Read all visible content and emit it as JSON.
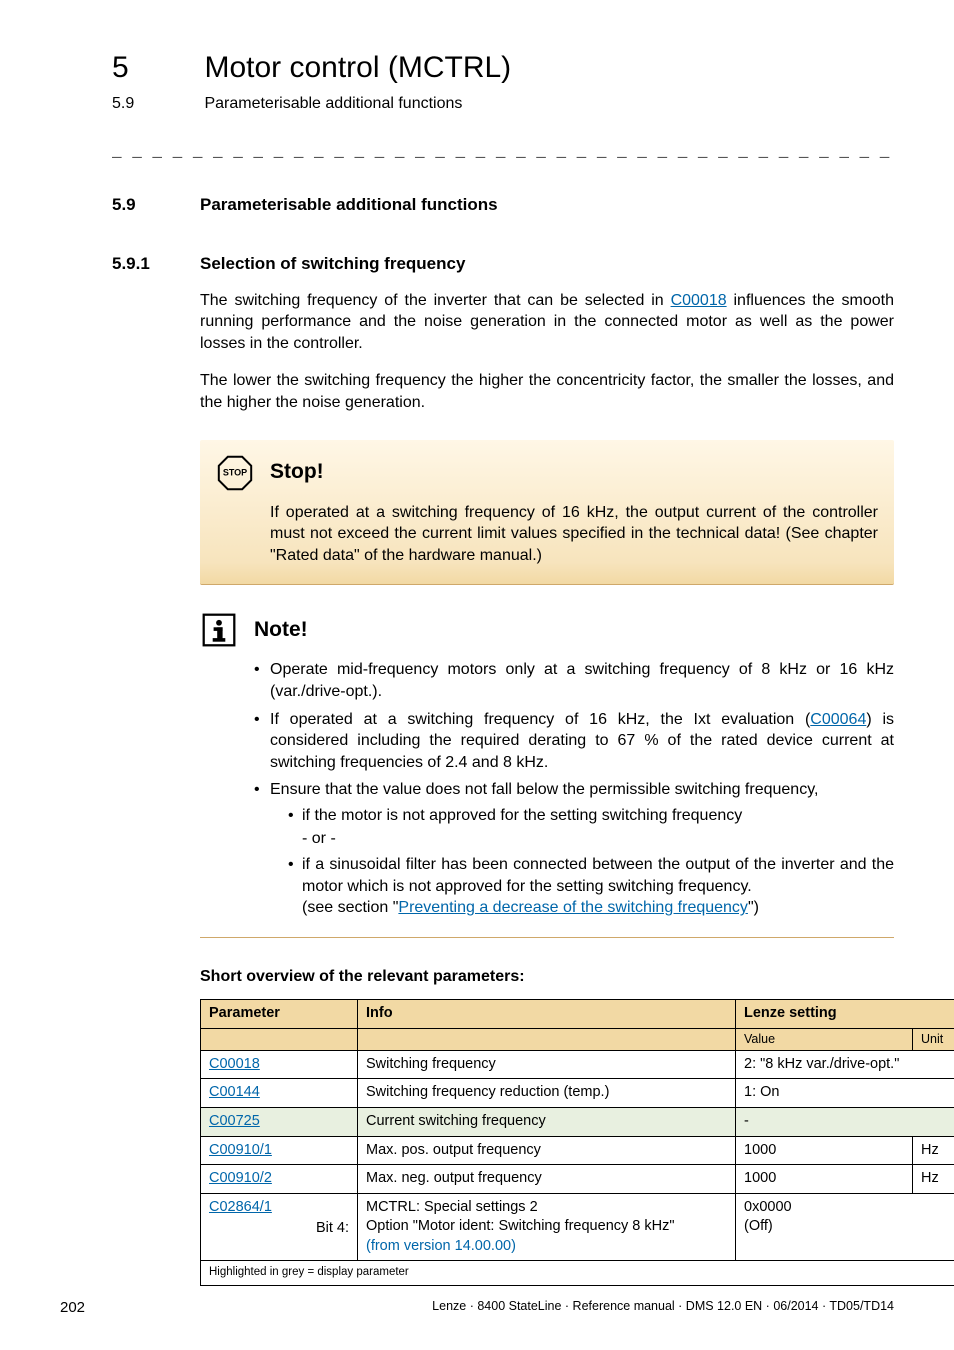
{
  "header": {
    "chapter_num": "5",
    "chapter_title": "Motor control (MCTRL)",
    "section_num": "5.9",
    "section_title": "Parameterisable additional functions"
  },
  "dashes": "_ _ _ _ _ _ _ _ _ _ _ _ _ _ _ _ _ _ _ _ _ _ _ _ _ _ _ _ _ _ _ _ _ _ _ _ _ _ _ _ _ _ _ _ _ _ _ _ _ _ _ _ _ _ _ _ _ _ _ _ _ _ _ _",
  "h59": {
    "num": "5.9",
    "text": "Parameterisable additional functions"
  },
  "h591": {
    "num": "5.9.1",
    "text": "Selection of switching frequency"
  },
  "p1a": "The switching frequency of the inverter that can be selected in ",
  "p1_link": "C00018",
  "p1b": " influences the smooth running performance and the noise generation in the connected motor as well as the power losses in the controller.",
  "p2": "The lower the switching frequency the higher the concentricity factor, the smaller the losses, and the higher the noise generation.",
  "stop": {
    "title": "Stop!",
    "body": "If operated at a switching frequency of 16 kHz, the output current of the controller must not exceed the current limit values specified in the technical data! (See chapter \"Rated data\" of the hardware manual.)"
  },
  "note": {
    "title": "Note!",
    "b1": "Operate mid-frequency motors only at a switching frequency of 8 kHz or 16 kHz (var./drive-opt.).",
    "b2a": "If operated at a switching frequency of 16 kHz, the Ixt evaluation (",
    "b2_link": "C00064",
    "b2b": ") is considered including the required derating to 67 % of the rated device current at switching frequencies of 2.4 and 8 kHz.",
    "b3": "Ensure that the value does not fall below the permissible switching frequency,",
    "b3_1": "if the motor is not approved for the setting switching frequency",
    "b3_or": "- or -",
    "b3_2a": "if a sinusoidal filter has been connected between the output of the inverter and the motor which is not approved for the setting switching frequency.",
    "b3_2b_pre": "(see section \"",
    "b3_2b_link": "Preventing a decrease of the switching frequency",
    "b3_2b_post": "\")"
  },
  "table": {
    "caption": "Short overview of the relevant parameters:",
    "head": {
      "param": "Parameter",
      "info": "Info",
      "lenze": "Lenze setting",
      "value": "Value",
      "unit": "Unit"
    },
    "rows": [
      {
        "param": "C00018",
        "info": "Switching frequency",
        "val": "2: \"8 kHz var./drive-opt.\"",
        "unit": "",
        "grey": false,
        "merged": true
      },
      {
        "param": "C00144",
        "info": "Switching frequency reduction (temp.)",
        "val": "1: On",
        "unit": "",
        "grey": false,
        "merged": true
      },
      {
        "param": "C00725",
        "info": "Current switching frequency",
        "val": "-",
        "unit": "",
        "grey": true,
        "merged": true
      },
      {
        "param": "C00910/1",
        "info": "Max. pos. output frequency",
        "val": "1000",
        "unit": "Hz",
        "grey": false,
        "merged": false
      },
      {
        "param": "C00910/2",
        "info": "Max. neg. output frequency",
        "val": "1000",
        "unit": "Hz",
        "grey": false,
        "merged": false
      }
    ],
    "row6": {
      "param": "C02864/1",
      "bit": "Bit 4:",
      "info1": "MCTRL: Special settings 2",
      "info2": "Option \"Motor ident: Switching frequency 8 kHz\"",
      "info3": "(from version 14.00.00)",
      "val1": "0x0000",
      "val2": "(Off)"
    },
    "footnote": "Highlighted in grey = display parameter"
  },
  "footer": {
    "page": "202",
    "right": "Lenze · 8400 StateLine · Reference manual · DMS 12.0 EN · 06/2014 · TD05/TD14"
  }
}
